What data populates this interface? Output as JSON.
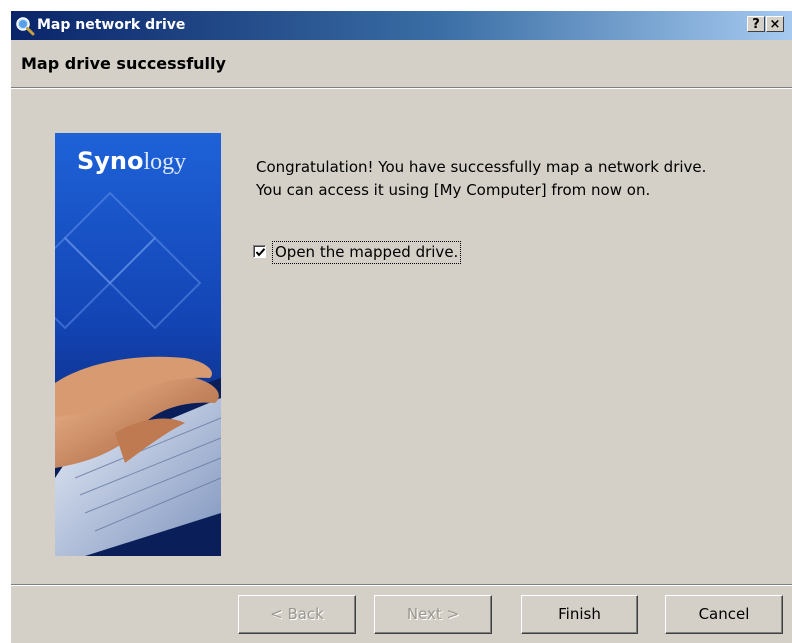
{
  "window": {
    "title": "Map network drive",
    "help_label": "?",
    "close_label": "×"
  },
  "header": {
    "title": "Map drive successfully"
  },
  "banner": {
    "brand_bold": "Syno",
    "brand_light": "logy",
    "icon": "keyboard-hands-image"
  },
  "content": {
    "message_line1": "Congratulation! You have successfully map a network drive.",
    "message_line2": "You can access it using [My Computer] from now on.",
    "checkbox_label": "Open the mapped drive.",
    "checkbox_checked": true
  },
  "buttons": {
    "back": "< Back",
    "next": "Next >",
    "finish": "Finish",
    "cancel": "Cancel"
  },
  "colors": {
    "titlebar_start": "#0a246a",
    "titlebar_end": "#a6caf0",
    "dialog_bg": "#d4d0c8",
    "banner_blue": "#1b4fc4"
  }
}
